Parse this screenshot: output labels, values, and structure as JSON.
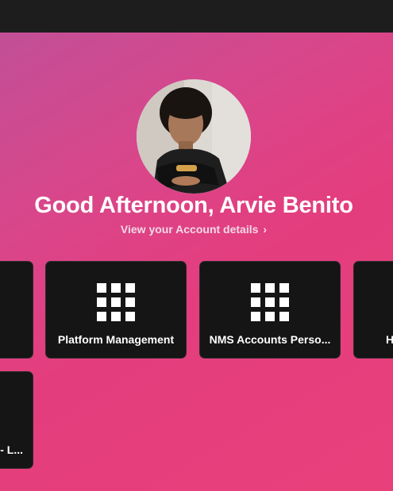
{
  "greeting": "Good Afternoon, Arvie Benito",
  "account_link": {
    "label": "View your Account details",
    "chevron": "›"
  },
  "tiles": [
    {
      "label": "Platform Management",
      "icon": "app-grid-icon"
    },
    {
      "label": "NMS Accounts Perso...",
      "icon": "app-grid-icon"
    },
    {
      "label": "H",
      "icon": "app-grid-icon"
    },
    {
      "label": "- L...",
      "icon": "app-grid-icon"
    }
  ],
  "colors": {
    "topbar": "#1d1d1d",
    "tile_bg": "#151515",
    "hero_gradient_start": "#c24f97",
    "hero_gradient_end": "#e8407a"
  }
}
